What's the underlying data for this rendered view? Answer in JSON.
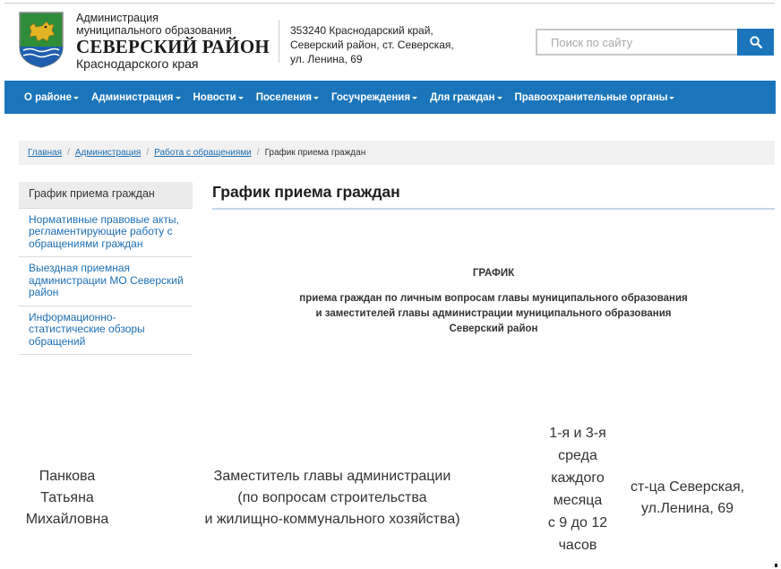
{
  "header": {
    "org_line1": "Администрация",
    "org_line2": "муниципального образования",
    "org_line3": "СЕВЕРСКИЙ РАЙОН",
    "org_line4": "Краснодарского края",
    "address_line1": "353240 Краснодарский край,",
    "address_line2": "Северский район, ст. Северская,",
    "address_line3": "ул. Ленина, 69",
    "search_placeholder": "Поиск по сайту",
    "search_icon": "search-icon",
    "logo_icon": "coat-of-arms-icon"
  },
  "nav": {
    "items": [
      {
        "label": "О районе"
      },
      {
        "label": "Администрация"
      },
      {
        "label": "Новости"
      },
      {
        "label": "Поселения"
      },
      {
        "label": "Госучреждения"
      },
      {
        "label": "Для граждан"
      },
      {
        "label": "Правоохранительные органы"
      }
    ]
  },
  "breadcrumb": {
    "items": [
      "Главная",
      "Администрация",
      "Работа с обращениями"
    ],
    "current": "График приема граждан"
  },
  "sidebar": {
    "items": [
      {
        "label": "График приема граждан",
        "active": true
      },
      {
        "label": "Нормативные правовые акты, регламентирующие работу с обращениями граждан"
      },
      {
        "label": "Выездная приемная администрации МО Северский район"
      },
      {
        "label": "Информационно-статистические обзоры обращений"
      }
    ]
  },
  "main": {
    "title": "График приема граждан",
    "doc_heading": "ГРАФИК",
    "doc_sub_line1": "приема граждан по личным вопросам главы муниципального образования",
    "doc_sub_line2": "и заместителей главы администрации муниципального образования",
    "doc_sub_line3": "Северский район",
    "row": {
      "name_line1": "Панкова",
      "name_line2": "Татьяна",
      "name_line3": "Михайловна",
      "role_line1": "Заместитель главы администрации",
      "role_line2": "(по вопросам строительства",
      "role_line3": "и жилищно-коммунального хозяйства)",
      "time_line1": "1-я и 3-я",
      "time_line2": "среда",
      "time_line3": "каждого",
      "time_line4": "месяца",
      "time_line5": "с 9 до 12",
      "time_line6": "часов",
      "place_line1": "ст-ца Северская,",
      "place_line2": "ул.Ленина, 69"
    }
  },
  "colors": {
    "brand_blue": "#1b75bb",
    "link_blue": "#1b6fb5"
  }
}
